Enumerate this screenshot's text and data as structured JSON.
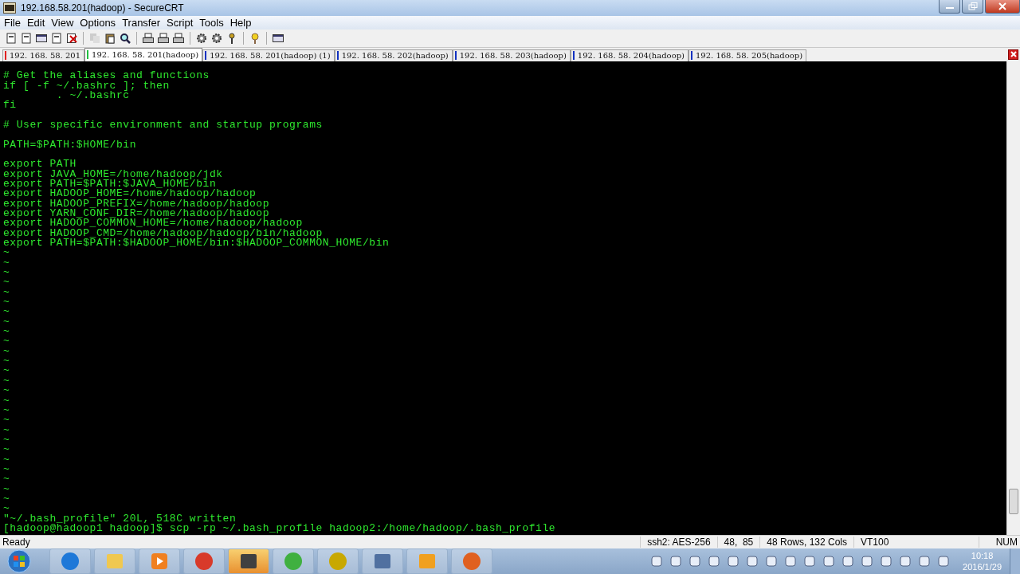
{
  "window": {
    "title": "192.168.58.201(hadoop) - SecureCRT"
  },
  "menu": [
    "File",
    "Edit",
    "View",
    "Options",
    "Transfer",
    "Script",
    "Tools",
    "Help"
  ],
  "tabs": [
    {
      "label": "192. 168. 58. 201",
      "color": "#e02020",
      "selected": false
    },
    {
      "label": "192. 168. 58. 201(hadoop)",
      "color": "#20c040",
      "selected": true
    },
    {
      "label": "192. 168. 58. 201(hadoop)  (1)",
      "color": "#1030c0",
      "selected": false
    },
    {
      "label": "192. 168. 58. 202(hadoop)",
      "color": "#1030c0",
      "selected": false
    },
    {
      "label": "192. 168. 58. 203(hadoop)",
      "color": "#1030c0",
      "selected": false
    },
    {
      "label": "192. 168. 58. 204(hadoop)",
      "color": "#1030c0",
      "selected": false
    },
    {
      "label": "192. 168. 58. 205(hadoop)",
      "color": "#1030c0",
      "selected": false
    }
  ],
  "terminal": {
    "lines": [
      {
        "kind": "blank"
      },
      {
        "kind": "text",
        "text": "# Get the aliases and functions"
      },
      {
        "kind": "text",
        "text": "if [ -f ~/.bashrc ]; then"
      },
      {
        "kind": "text",
        "text": "        . ~/.bashrc"
      },
      {
        "kind": "text",
        "text": "fi"
      },
      {
        "kind": "blank"
      },
      {
        "kind": "text",
        "text": "# User specific environment and startup programs"
      },
      {
        "kind": "blank"
      },
      {
        "kind": "text",
        "text": "PATH=$PATH:$HOME/bin"
      },
      {
        "kind": "blank"
      },
      {
        "kind": "text",
        "text": "export PATH"
      },
      {
        "kind": "text",
        "text": "export JAVA_HOME=/home/hadoop/jdk"
      },
      {
        "kind": "text",
        "text": "export PATH=$PATH:$JAVA_HOME/bin"
      },
      {
        "kind": "text",
        "text": "export HADOOP_HOME=/home/hadoop/hadoop"
      },
      {
        "kind": "text",
        "text": "export HADOOP_PREFIX=/home/hadoop/hadoop"
      },
      {
        "kind": "text",
        "text": "export YARN_CONF_DIR=/home/hadoop/hadoop"
      },
      {
        "kind": "text",
        "text": "export HADOOP_COMMON_HOME=/home/hadoop/hadoop"
      },
      {
        "kind": "text",
        "text": "export HADOOP_CMD=/home/hadoop/hadoop/bin/hadoop"
      },
      {
        "kind": "text",
        "text": "export PATH=$PATH:$HADOOP_HOME/bin:$HADOOP_COMMON_HOME/bin"
      },
      {
        "kind": "text",
        "text": "~"
      },
      {
        "kind": "text",
        "text": "~"
      },
      {
        "kind": "text",
        "text": "~"
      },
      {
        "kind": "text",
        "text": "~"
      },
      {
        "kind": "text",
        "text": "~"
      },
      {
        "kind": "text",
        "text": "~"
      },
      {
        "kind": "text",
        "text": "~"
      },
      {
        "kind": "text",
        "text": "~"
      },
      {
        "kind": "text",
        "text": "~"
      },
      {
        "kind": "text",
        "text": "~"
      },
      {
        "kind": "text",
        "text": "~"
      },
      {
        "kind": "text",
        "text": "~"
      },
      {
        "kind": "text",
        "text": "~"
      },
      {
        "kind": "text",
        "text": "~"
      },
      {
        "kind": "text",
        "text": "~"
      },
      {
        "kind": "text",
        "text": "~"
      },
      {
        "kind": "text",
        "text": "~"
      },
      {
        "kind": "text",
        "text": "~"
      },
      {
        "kind": "text",
        "text": "~"
      },
      {
        "kind": "text",
        "text": "~"
      },
      {
        "kind": "text",
        "text": "~"
      },
      {
        "kind": "text",
        "text": "~"
      },
      {
        "kind": "text",
        "text": "~"
      },
      {
        "kind": "text",
        "text": "~"
      },
      {
        "kind": "text",
        "text": "~"
      },
      {
        "kind": "text",
        "text": "~"
      },
      {
        "kind": "text",
        "text": "~"
      },
      {
        "kind": "text",
        "text": "\"~/.bash_profile\" 20L, 518C written"
      },
      {
        "kind": "text",
        "text": "[hadoop@hadoop1 hadoop]$ scp -rp ~/.bash_profile hadoop2:/home/hadoop/.bash_profile"
      }
    ]
  },
  "status_bar": {
    "message": "Ready",
    "protocol": "ssh2: AES-256",
    "cursor": "48,  85",
    "size": "48 Rows, 132 Cols",
    "emulation": "VT100",
    "num_lock": "NUM"
  },
  "taskbar": {
    "clock_time": "10:18",
    "clock_date": "2016/1/29"
  }
}
